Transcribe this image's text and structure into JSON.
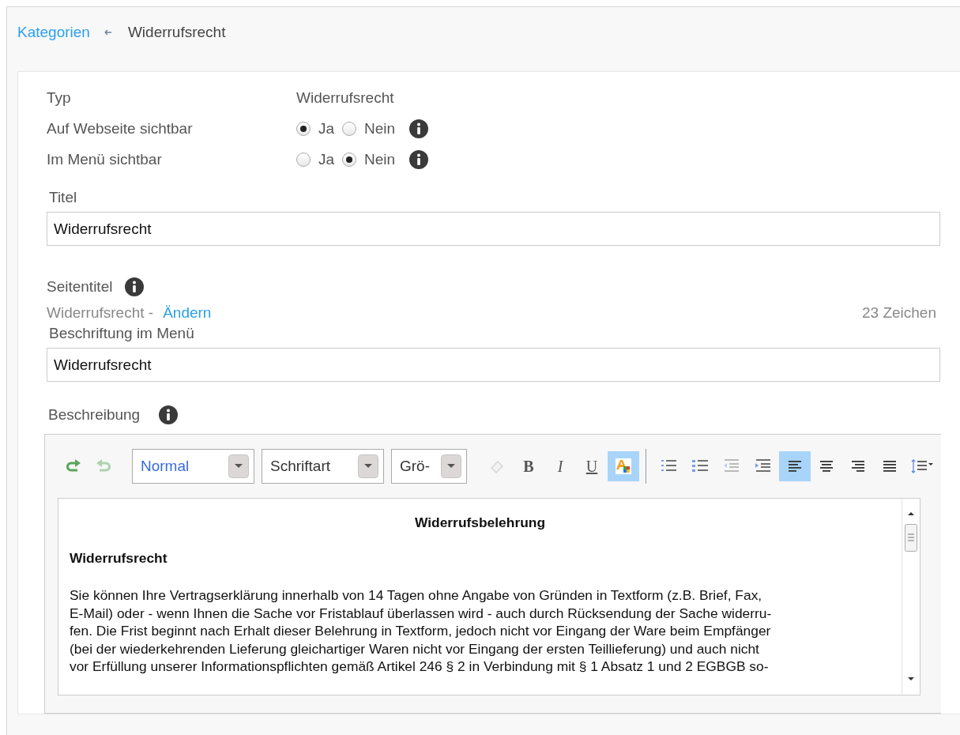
{
  "breadcrumb": {
    "link": "Kategorien",
    "current": "Widerrufsrecht"
  },
  "info_rows": [
    {
      "label": "Typ",
      "kind": "text",
      "value": "Widerrufsrecht"
    },
    {
      "label": "Auf Webseite sichtbar",
      "kind": "radio",
      "info": true,
      "options": [
        {
          "label": "Ja",
          "selected": true
        },
        {
          "label": "Nein",
          "selected": false
        }
      ]
    },
    {
      "label": "Im Menü sichtbar",
      "kind": "radio",
      "info": true,
      "options": [
        {
          "label": "Ja",
          "selected": false
        },
        {
          "label": "Nein",
          "selected": true
        }
      ]
    }
  ],
  "title_field": {
    "label": "Titel",
    "value": "Widerrufsrecht"
  },
  "page_title": {
    "label": "Seitentitel",
    "info": true,
    "preview": "Widerrufsrecht -",
    "link": "Ändern",
    "count": "23 Zeichen"
  },
  "menu_label_field": {
    "label": "Beschriftung im Menü",
    "value": "Widerrufsrecht"
  },
  "description": {
    "label": "Beschreibung",
    "info": true,
    "toolbar": [
      {
        "kind": "undo",
        "disabled": false
      },
      {
        "kind": "redo",
        "disabled": true
      },
      {
        "kind": "dropdown",
        "value": "Normal"
      },
      {
        "kind": "dropdown",
        "value": "Schriftart"
      },
      {
        "kind": "dropdown",
        "value": "Grö-"
      },
      {
        "kind": "eraser",
        "disabled": true
      },
      {
        "kind": "bold",
        "label": "B"
      },
      {
        "kind": "italic",
        "label": "I"
      },
      {
        "kind": "underline",
        "label": "U"
      },
      {
        "kind": "font-color",
        "selected": true
      },
      {
        "kind": "separator"
      },
      {
        "kind": "ordered-list",
        "selected": false
      },
      {
        "kind": "bullet-list",
        "selected": false
      },
      {
        "kind": "outdent",
        "disabled": true
      },
      {
        "kind": "indent",
        "disabled": false
      },
      {
        "kind": "align-left",
        "selected": true
      },
      {
        "kind": "align-center",
        "selected": false
      },
      {
        "kind": "align-right",
        "selected": false
      },
      {
        "kind": "justify",
        "selected": false
      },
      {
        "kind": "line-height"
      }
    ],
    "content": {
      "heading": "Widerrufsbelehrung",
      "subheading": "Widerrufsrecht",
      "lines": [
        "Sie können Ihre Vertragserklärung innerhalb von 14 Tagen ohne Angabe von Gründen in Textform (z.B. Brief, Fax,",
        "E-Mail) oder - wenn Ihnen die Sache vor Fristablauf überlassen wird - auch durch Rücksendung der Sache widerru-",
        "fen. Die Frist beginnt nach Erhalt dieser Belehrung in Textform, jedoch nicht vor Eingang der Ware beim Empfänger",
        "(bei der wiederkehrenden Lieferung gleichartiger Waren nicht vor Eingang der ersten Teillieferung) und auch nicht",
        "vor Erfüllung unserer Informationspflichten gemäß Artikel 246 § 2 in Verbindung mit § 1 Absatz 1 und 2 EGBGB so-"
      ]
    }
  }
}
